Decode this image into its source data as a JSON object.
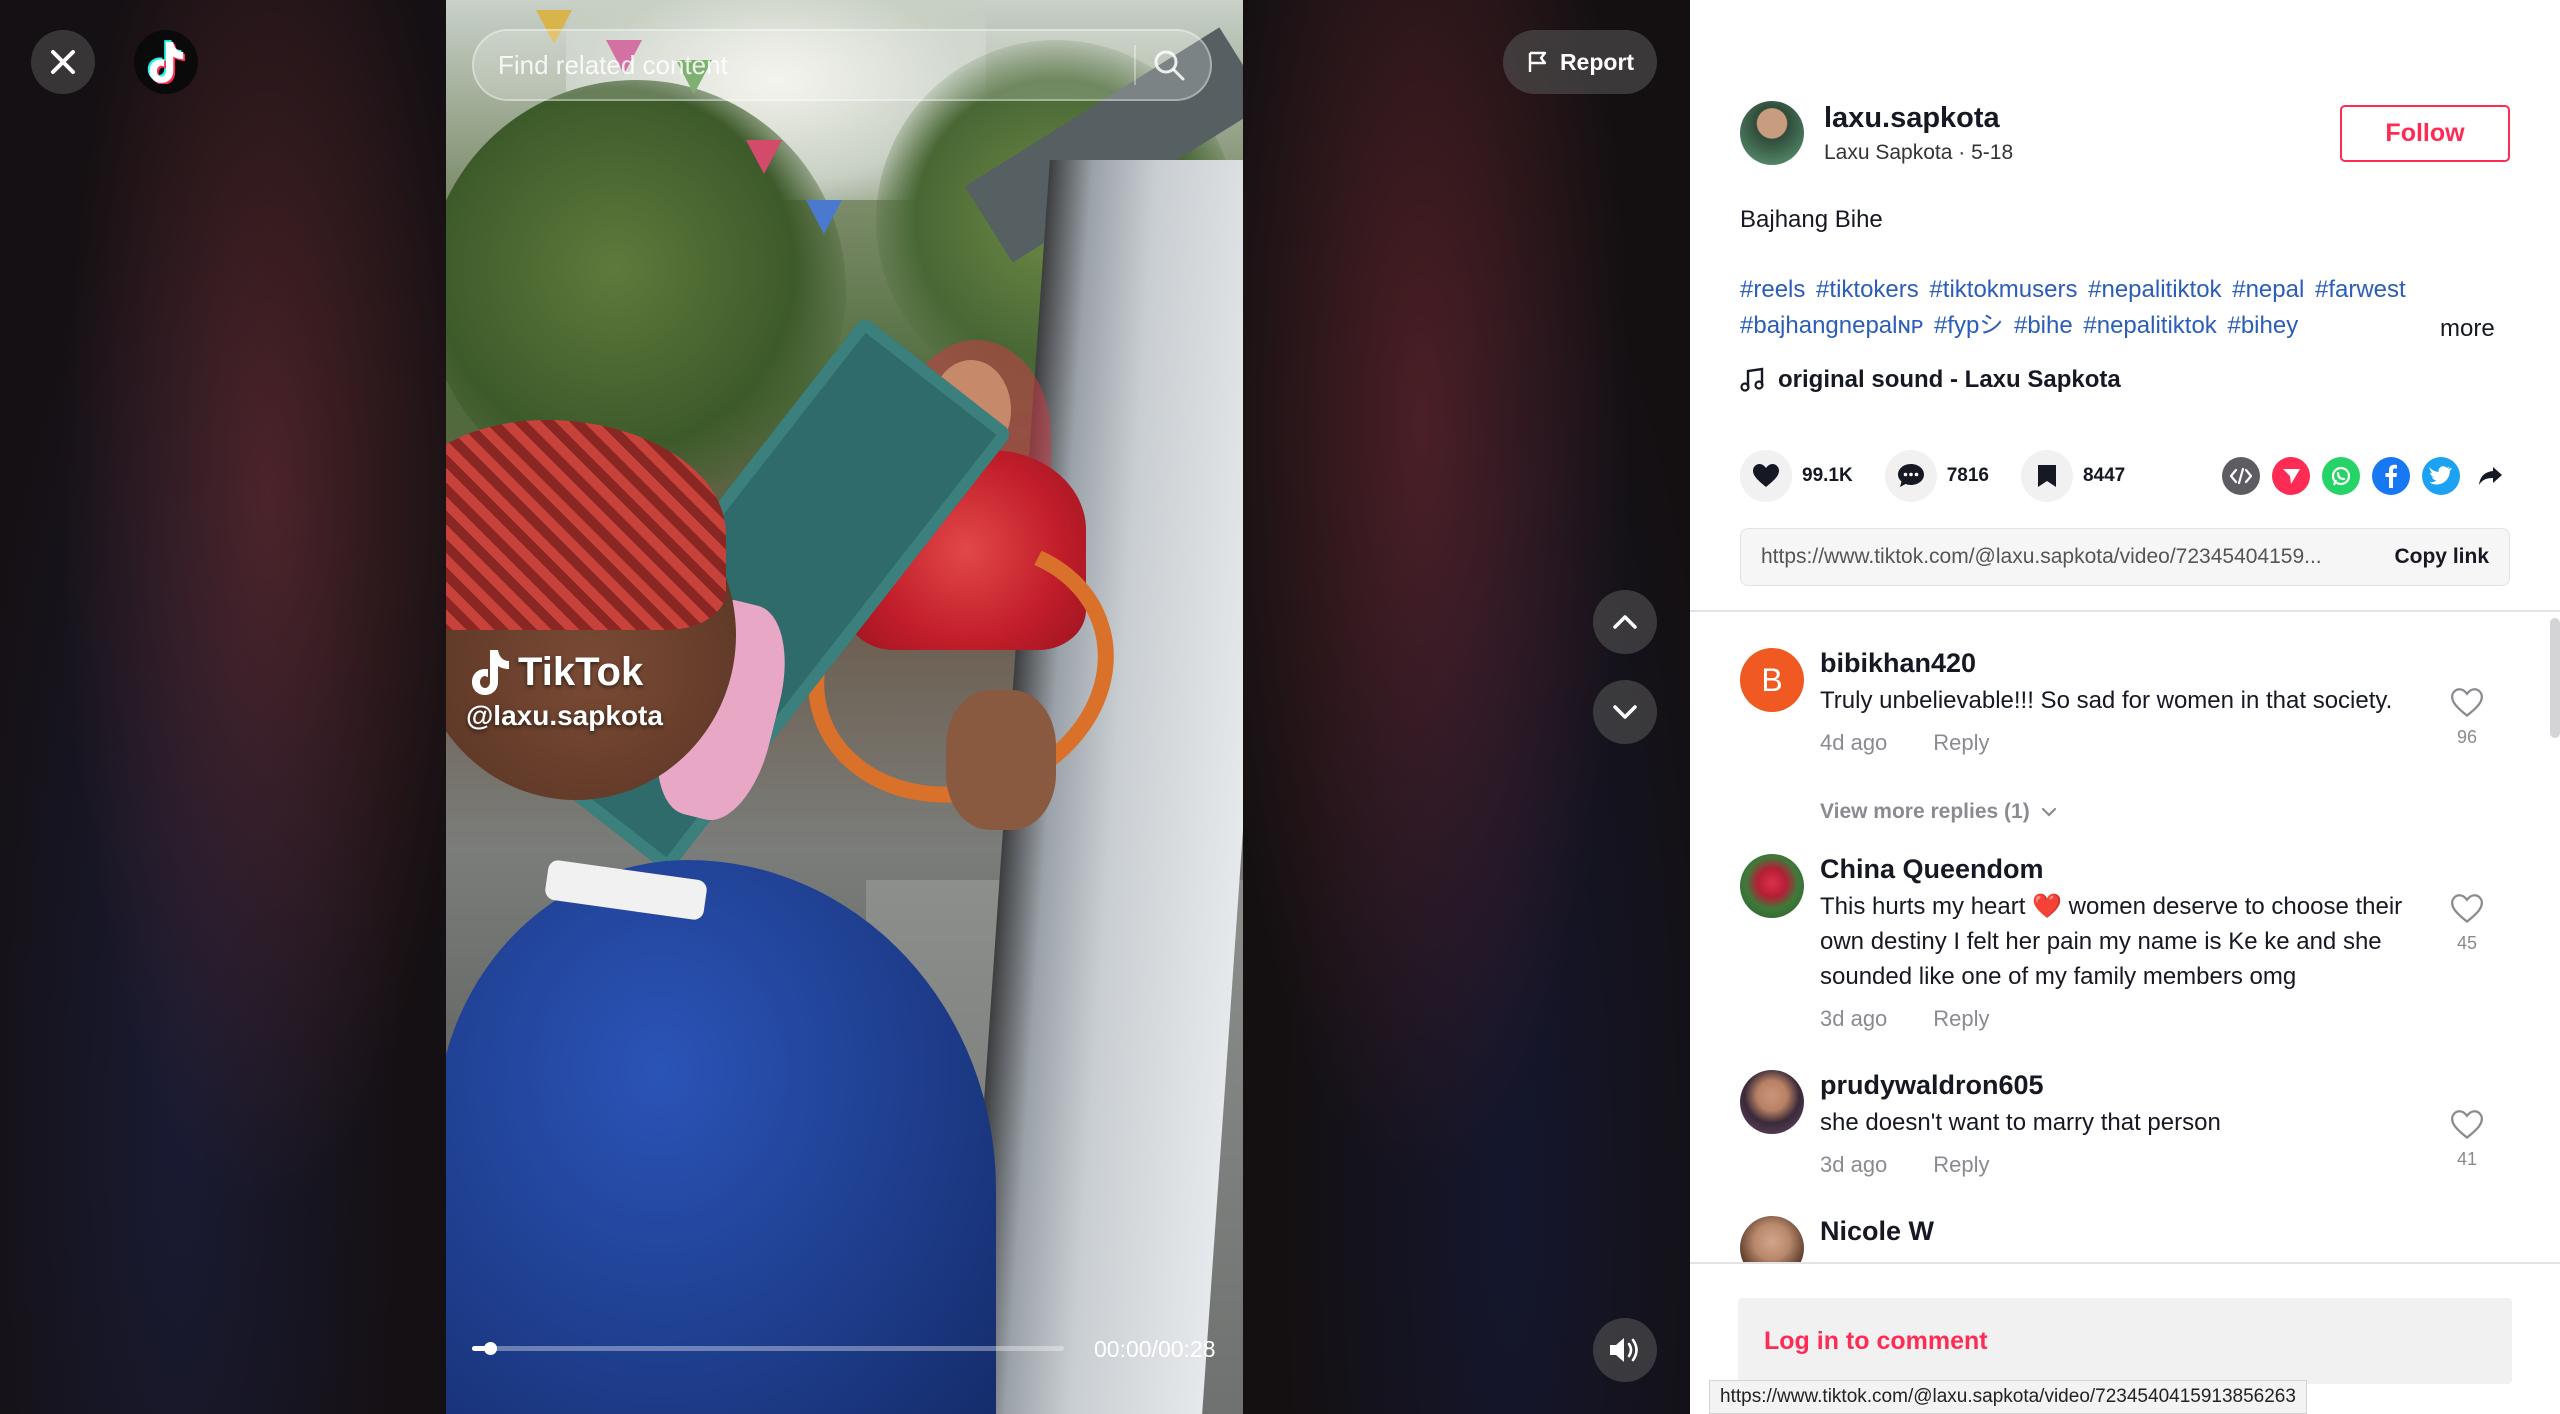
{
  "video": {
    "search_placeholder": "Find related content",
    "report_label": "Report",
    "watermark_brand": "TikTok",
    "watermark_handle": "@laxu.sapkota",
    "time": "00:00/00:28",
    "progress": 0.03,
    "icons": [
      "close-icon",
      "tiktok-logo-icon",
      "search-icon",
      "flag-icon",
      "chevron-up-icon",
      "chevron-down-icon",
      "volume-icon"
    ]
  },
  "author": {
    "username": "laxu.sapkota",
    "display_name": "Laxu Sapkota",
    "date": "5-18",
    "sub_line": "Laxu Sapkota · 5-18",
    "follow_label": "Follow"
  },
  "post": {
    "title": "Bajhang Bihe",
    "hashtags": [
      "#reels",
      "#tiktokers",
      "#tiktokmusers",
      "#nepalitiktok",
      "#nepal",
      "#farwest",
      "#bajhangnepalɴᴘ",
      "#fypシ",
      "#bihe",
      "#nepalitiktok",
      "#bihey"
    ],
    "more_label": "more",
    "sound": "original sound - Laxu Sapkota"
  },
  "actions": {
    "likes": "99.1K",
    "comments": "7816",
    "saves": "8447",
    "share_icons": [
      "embed-icon",
      "send-icon",
      "whatsapp-icon",
      "facebook-icon",
      "twitter-icon",
      "share-arrow-icon"
    ]
  },
  "link": {
    "url": "https://www.tiktok.com/@laxu.sapkota/video/72345404159...",
    "copy_label": "Copy link"
  },
  "comments": [
    {
      "name": "bibikhan420",
      "avatar_letter": "B",
      "text": "Truly unbelievable!!! So sad for women in that society.",
      "time": "4d ago",
      "reply_label": "Reply",
      "likes": "96",
      "view_replies": "View more replies (1)"
    },
    {
      "name": "China Queendom",
      "text_before": "This hurts my heart ",
      "emoji": "❤️",
      "text_after": "women deserve to choose their own destiny I felt her pain my name is Ke ke and she sounded like one of my family members omg",
      "time": "3d ago",
      "reply_label": "Reply",
      "likes": "45"
    },
    {
      "name": "prudywaldron605",
      "text": "she doesn't want to marry that person",
      "time": "3d ago",
      "reply_label": "Reply",
      "likes": "41"
    },
    {
      "name": "Nicole W"
    }
  ],
  "footer": {
    "login_label": "Log in to comment"
  },
  "status_bar": {
    "url": "https://www.tiktok.com/@laxu.sapkota/video/7234540415913856263"
  },
  "colors": {
    "accent": "#fe2c55",
    "hashtag": "#2b5db9",
    "muted": "#8a8b91",
    "text": "#161823"
  }
}
